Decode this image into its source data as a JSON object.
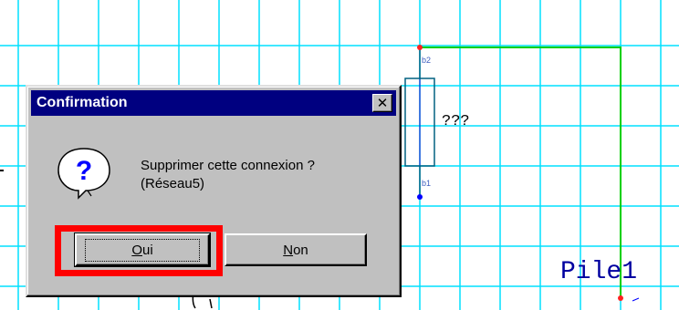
{
  "schematic": {
    "resistor_value": "???",
    "pin_top": "b2",
    "pin_bottom": "b1",
    "component_label": "Pile1"
  },
  "dialog": {
    "title": "Confirmation",
    "close_glyph": "✕",
    "icon": "question-balloon-icon",
    "message_line1": "Supprimer cette connexion ?",
    "message_line2": "(Réseau5)",
    "buttons": {
      "yes_accel": "O",
      "yes_rest": "ui",
      "no_accel": "N",
      "no_rest": "on"
    }
  },
  "colors": {
    "grid": "#00e0ff",
    "wire": "#00d000",
    "node_red": "#ff2020",
    "node_blue": "#0000ff",
    "titlebar": "#000080",
    "highlight": "#ff0000"
  }
}
